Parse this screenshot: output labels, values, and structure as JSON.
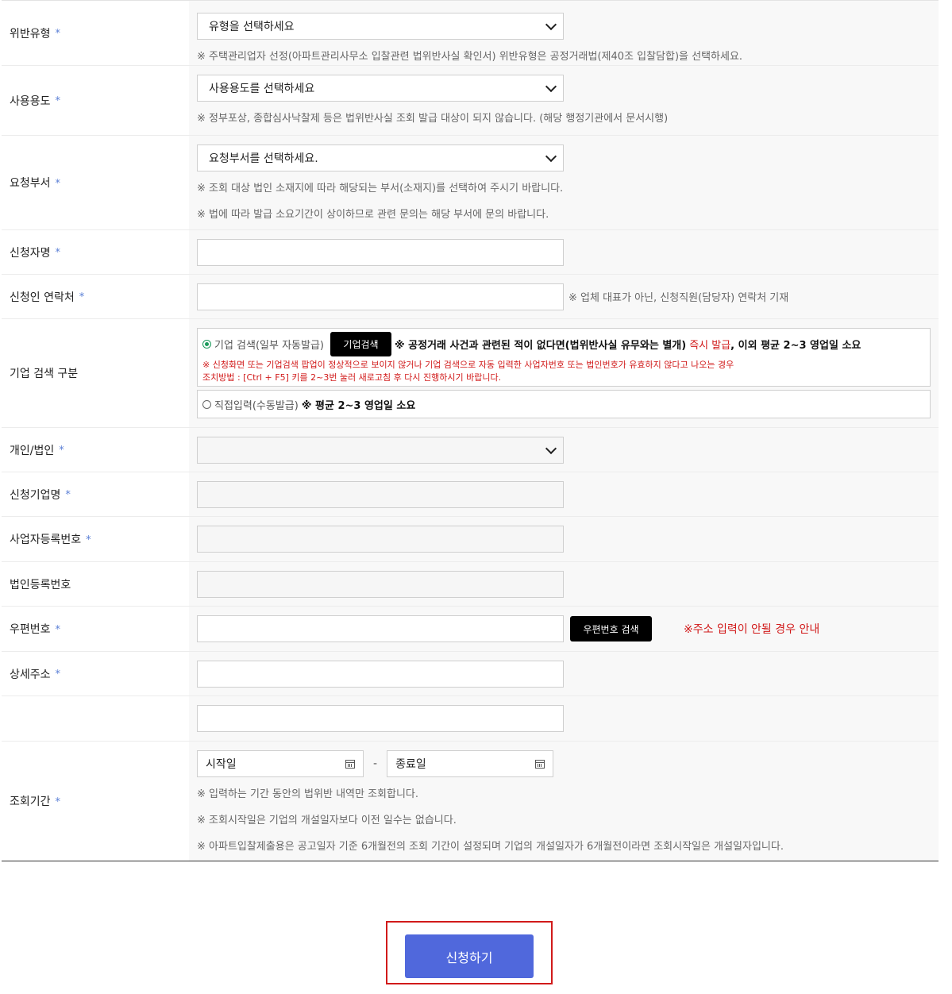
{
  "form": {
    "violation_type": {
      "label": "위반유형",
      "placeholder": "유형을 선택하세요",
      "note": "※ 주택관리업자 선정(아파트관리사무소 입찰관련 법위반사실 확인서) 위반유형은 공정거래법(제40조 입찰담합)을 선택하세요."
    },
    "usage": {
      "label": "사용용도",
      "placeholder": "사용용도를 선택하세요",
      "note": "※ 정부포상, 종합심사낙찰제 등은 법위반사실 조회 발급 대상이 되지 않습니다. (해당 행정기관에서 문서시행)"
    },
    "department": {
      "label": "요청부서",
      "placeholder": "요청부서를 선택하세요.",
      "note1": "※ 조회 대상 법인 소재지에 따라 해당되는 부서(소재지)를 선택하여 주시기 바랍니다.",
      "note2": "※ 법에 따라 발급 소요기간이 상이하므로 관련 문의는 해당 부서에 문의 바랍니다."
    },
    "applicant_name": {
      "label": "신청자명"
    },
    "applicant_contact": {
      "label": "신청인 연락처",
      "note": "※ 업체 대표가 아닌, 신청직원(담당자) 연락처 기재"
    },
    "company_search": {
      "label": "기업 검색 구분",
      "option1_label": "기업 검색(일부 자동발급)",
      "search_button": "기업검색",
      "option1_note_bold": "※ 공정거래 사건과 관련된 적이 없다면(법위반사실 유무와는 별개)",
      "option1_note_red": "즉시 발급",
      "option1_note_tail": ", 이외 평균 2~3 영업일 소요",
      "warning1": "※ 신청화면 또는 기업검색 팝업이 정상적으로 보이지 않거나 기업 검색으로 자동 입력한 사업자번호 또는 법인번호가 유효하지 않다고 나오는 경우",
      "warning2": "조치방법 : [Ctrl + F5] 키를 2~3번 눌러 새로고침 후 다시 진행하시기 바랍니다.",
      "option2_label": "직접입력(수동발급)",
      "option2_note": "※ 평균 2~3 영업일 소요"
    },
    "person_type": {
      "label": "개인/법인",
      "value": ""
    },
    "company_name": {
      "label": "신청기업명"
    },
    "business_reg_no": {
      "label": "사업자등록번호"
    },
    "corp_reg_no": {
      "label": "법인등록번호"
    },
    "postal_code": {
      "label": "우편번호",
      "search_button": "우편번호 검색",
      "help_link": "※주소 입력이 안될 경우 안내"
    },
    "address_detail": {
      "label": "상세주소"
    },
    "period": {
      "label": "조회기간",
      "start_placeholder": "시작일",
      "separator": "-",
      "end_placeholder": "종료일",
      "note1": "※ 입력하는 기간 동안의 법위반 내역만 조회합니다.",
      "note2": "※ 조회시작일은 기업의 개설일자보다 이전 일수는 없습니다.",
      "note3": "※ 아파트입찰제출용은 공고일자 기준 6개월전의 조회 기간이 설정되며 기업의 개설일자가 6개월전이라면 조회시작일은 개설일자입니다."
    },
    "required_mark": "*"
  },
  "submit": {
    "label": "신청하기"
  },
  "colors": {
    "accent": "#5068dc",
    "required": "#5a7fd6",
    "warning": "#d11a1a",
    "highlight_frame": "#d11a1a"
  }
}
